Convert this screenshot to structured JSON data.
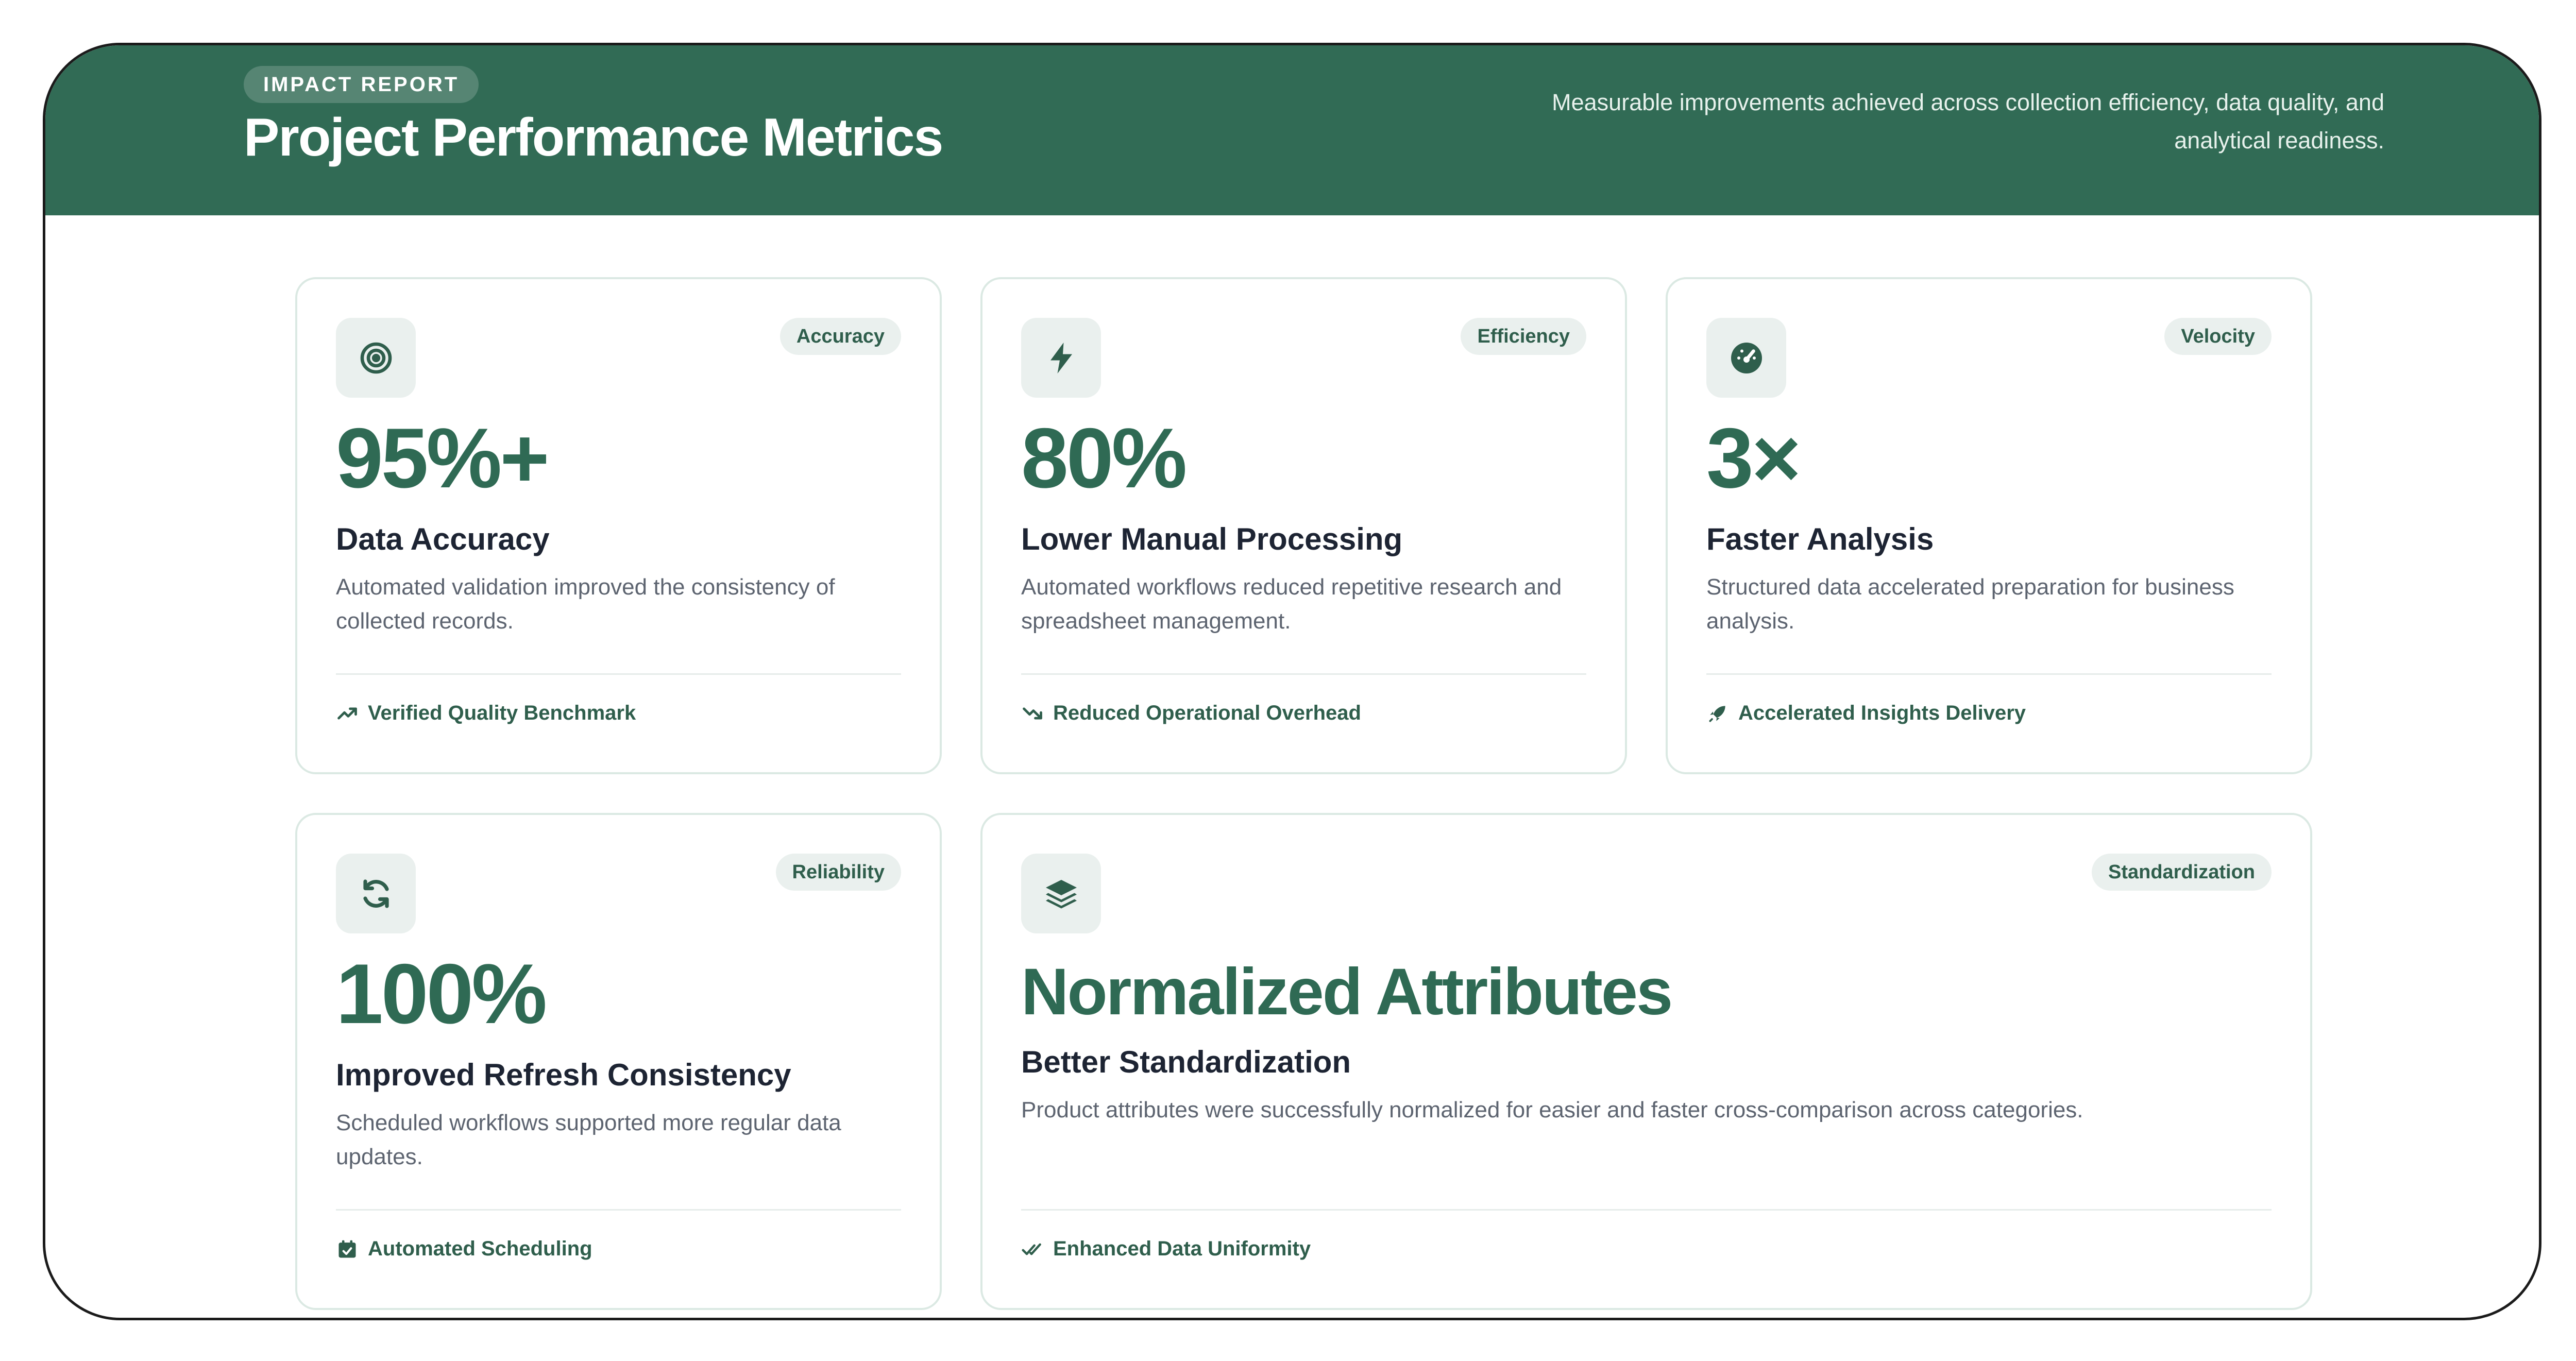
{
  "header": {
    "eyebrow": "IMPACT REPORT",
    "title": "Project Performance Metrics",
    "subtitle_line1": "Measurable improvements achieved across collection efficiency, data quality, and",
    "subtitle_line2": "analytical readiness."
  },
  "colors": {
    "brand_green": "#316b55",
    "metric_green": "#2f6a54",
    "chip_bg": "#eaf0ee",
    "card_border": "#dbe9e3"
  },
  "cards": [
    {
      "icon": "target-icon",
      "tag": "Accuracy",
      "metric": "95%+",
      "title": "Data Accuracy",
      "description": "Automated validation improved the consistency of collected records.",
      "footer_icon": "trend-up-icon",
      "footer": "Verified Quality Benchmark"
    },
    {
      "icon": "lightning-icon",
      "tag": "Efficiency",
      "metric": "80%",
      "title": "Lower Manual Processing",
      "description": "Automated workflows reduced repetitive research and spreadsheet management.",
      "footer_icon": "trend-down-icon",
      "footer": "Reduced Operational Overhead"
    },
    {
      "icon": "gauge-icon",
      "tag": "Velocity",
      "metric": "3×",
      "title": "Faster Analysis",
      "description": "Structured data accelerated preparation for business analysis.",
      "footer_icon": "rocket-icon",
      "footer": "Accelerated Insights Delivery"
    },
    {
      "icon": "refresh-icon",
      "tag": "Reliability",
      "metric": "100%",
      "title": "Improved Refresh Consistency",
      "description": "Scheduled workflows supported more regular data updates.",
      "footer_icon": "calendar-check-icon",
      "footer": "Automated Scheduling"
    },
    {
      "icon": "layers-icon",
      "tag": "Standardization",
      "metric": "Normalized Attributes",
      "title": "Better Standardization",
      "description": "Product attributes were successfully normalized for easier and faster cross-comparison across categories.",
      "footer_icon": "double-check-icon",
      "footer": "Enhanced Data Uniformity"
    }
  ]
}
